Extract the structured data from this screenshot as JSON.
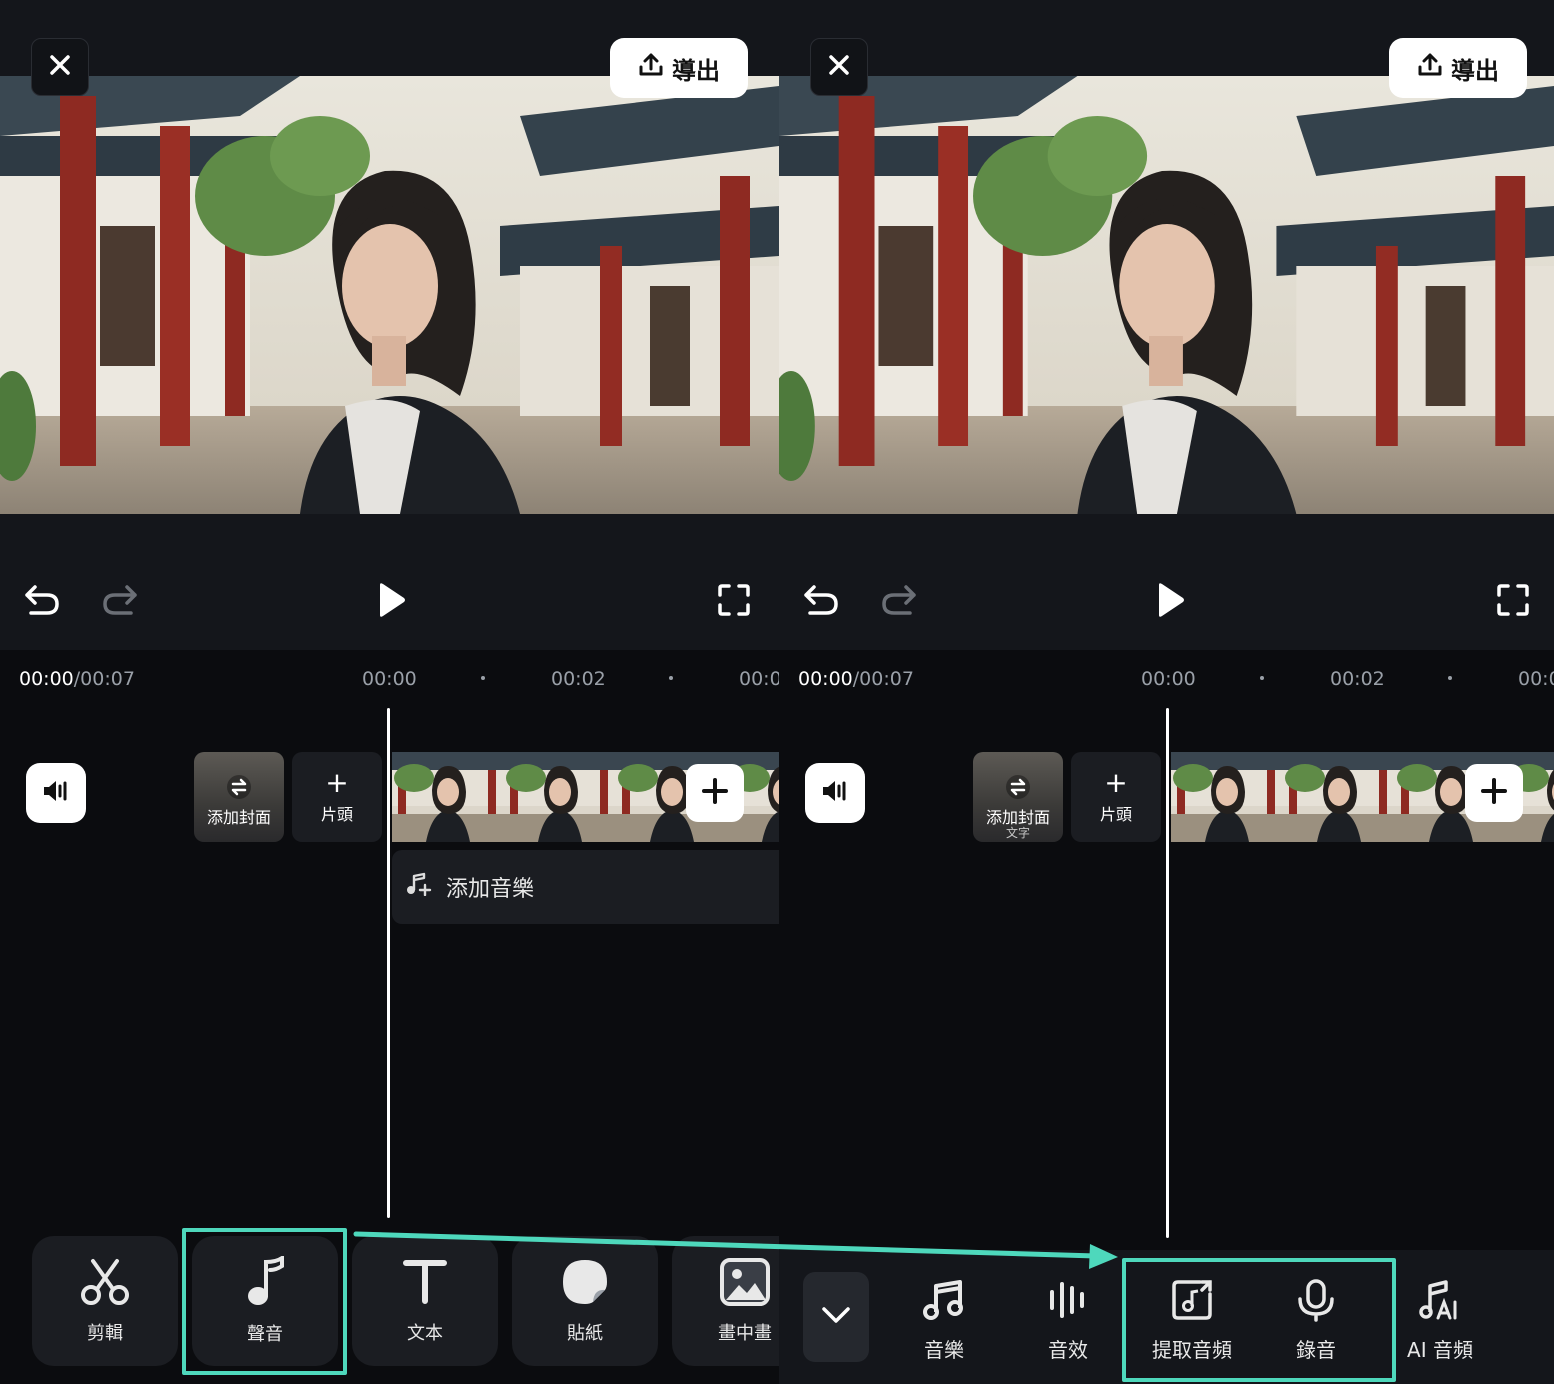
{
  "colors": {
    "accent_highlight": "#4ed8bc",
    "background": "#0b0c0f",
    "panel": "#14161b",
    "button_white": "#ffffff"
  },
  "left": {
    "topbar": {
      "close_icon": "close-icon",
      "export_label": "導出"
    },
    "controls": {
      "undo_icon": "undo-icon",
      "redo_icon": "redo-icon",
      "play_icon": "play-icon",
      "fullscreen_icon": "fullscreen-icon"
    },
    "timeline": {
      "current": "00:00",
      "total": "/00:07",
      "ticks": [
        "00:00",
        "00:02",
        "00:0"
      ],
      "cover_label": "添加封面",
      "intro_plus": "+",
      "intro_label": "片頭",
      "music_label": "添加音樂"
    },
    "toolbar": [
      {
        "label": "剪輯",
        "icon": "scissors-icon"
      },
      {
        "label": "聲音",
        "icon": "music-note-icon"
      },
      {
        "label": "文本",
        "icon": "text-icon"
      },
      {
        "label": "貼紙",
        "icon": "sticker-icon"
      },
      {
        "label": "畫中畫",
        "icon": "picture-in-picture-icon"
      }
    ]
  },
  "right": {
    "topbar": {
      "close_icon": "close-icon",
      "export_label": "導出"
    },
    "timeline": {
      "current": "00:00",
      "total": "/00:07",
      "ticks": [
        "00:00",
        "00:02",
        "00:0"
      ],
      "cover_label": "添加封面",
      "cover_sub": "文字",
      "intro_plus": "+",
      "intro_label": "片頭"
    },
    "sub_toolbar": [
      {
        "label": "音樂",
        "icon": "music-icon"
      },
      {
        "label": "音效",
        "icon": "sound-effect-icon"
      },
      {
        "label": "提取音頻",
        "icon": "extract-audio-icon"
      },
      {
        "label": "錄音",
        "icon": "microphone-icon"
      },
      {
        "label": "AI 音頻",
        "icon": "ai-audio-icon"
      }
    ]
  }
}
